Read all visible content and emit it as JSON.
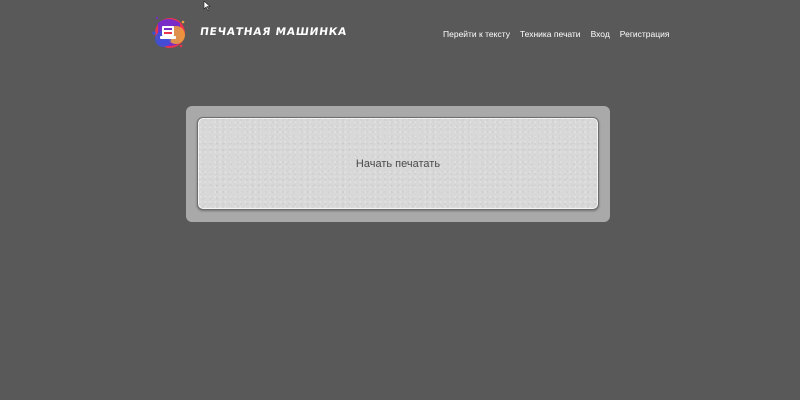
{
  "header": {
    "brand_name": "Печатная машинка",
    "logo_icon": "typewriter-logo-icon",
    "nav": {
      "go_to_text": "Перейти к тексту",
      "typing_technique": "Техника печати",
      "login": "Вход",
      "register": "Регистрация"
    }
  },
  "main": {
    "start_label": "Начать печатать"
  },
  "colors": {
    "background": "#595959",
    "frame": "#a9a9a9",
    "start_area": "#d8d8d8",
    "nav_text": "#ffffff",
    "start_text": "#4a4a4a"
  }
}
